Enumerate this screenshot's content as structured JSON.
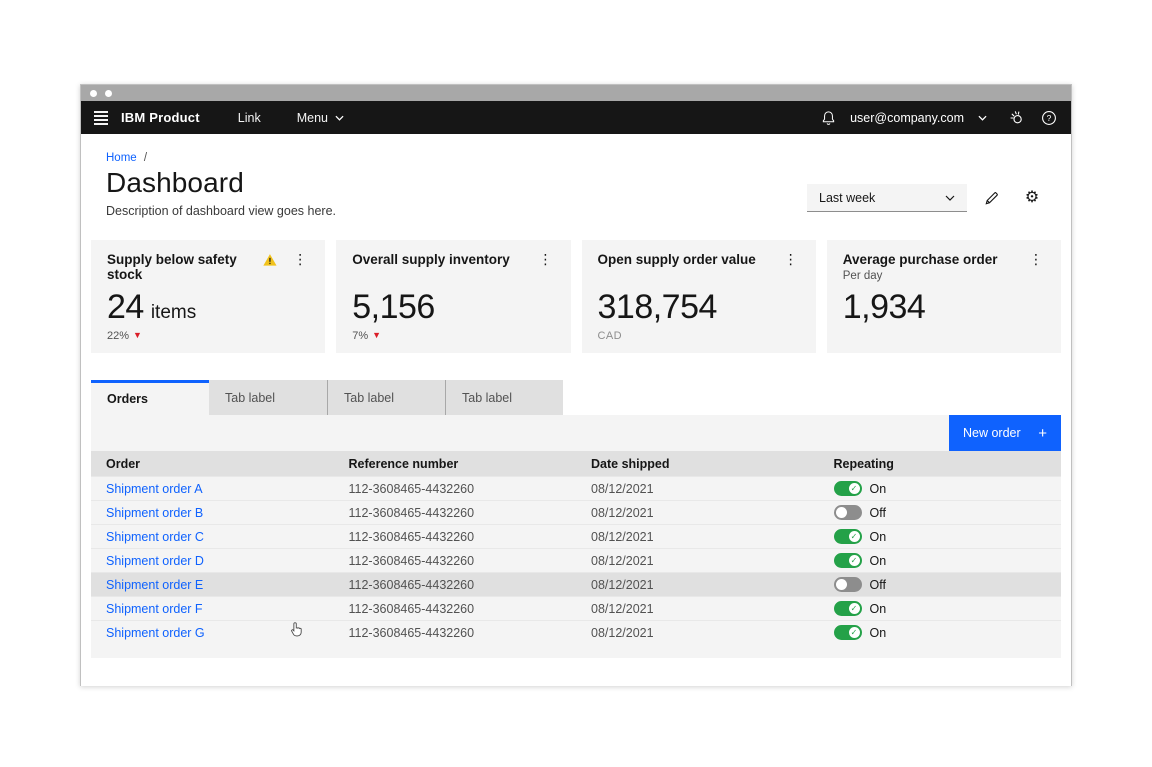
{
  "header": {
    "product": "IBM Product",
    "nav": [
      {
        "label": "Link"
      },
      {
        "label": "Menu"
      }
    ],
    "user_email": "user@company.com"
  },
  "breadcrumb": {
    "home_label": "Home",
    "separator": "/"
  },
  "page": {
    "title": "Dashboard",
    "description": "Description of dashboard view goes here."
  },
  "controls": {
    "dropdown_value": "Last week"
  },
  "cards": [
    {
      "title": "Supply below safety stock",
      "value": "24",
      "value_suffix": "items",
      "delta": "22%",
      "delta_dir": "down"
    },
    {
      "title": "Overall supply inventory",
      "value": "5,156",
      "delta": "7%",
      "delta_dir": "down"
    },
    {
      "title": "Open supply order value",
      "value": "318,754",
      "caption": "CAD"
    },
    {
      "title": "Average purchase order",
      "subtitle": "Per day",
      "value": "1,934"
    }
  ],
  "tabs": [
    {
      "label": "Orders",
      "active": true
    },
    {
      "label": "Tab label",
      "active": false
    },
    {
      "label": "Tab label",
      "active": false
    },
    {
      "label": "Tab label",
      "active": false
    }
  ],
  "table": {
    "new_order_label": "New order",
    "columns": [
      "Order",
      "Reference number",
      "Date shipped",
      "Repeating"
    ],
    "rows": [
      {
        "order": "Shipment order A",
        "reference": "112-3608465-4432260",
        "date": "08/12/2021",
        "repeating": "On"
      },
      {
        "order": "Shipment order B",
        "reference": "112-3608465-4432260",
        "date": "08/12/2021",
        "repeating": "Off"
      },
      {
        "order": "Shipment order C",
        "reference": "112-3608465-4432260",
        "date": "08/12/2021",
        "repeating": "On"
      },
      {
        "order": "Shipment order D",
        "reference": "112-3608465-4432260",
        "date": "08/12/2021",
        "repeating": "On"
      },
      {
        "order": "Shipment order E",
        "reference": "112-3608465-4432260",
        "date": "08/12/2021",
        "repeating": "Off",
        "hovered": true
      },
      {
        "order": "Shipment order F",
        "reference": "112-3608465-4432260",
        "date": "08/12/2021",
        "repeating": "On"
      },
      {
        "order": "Shipment order G",
        "reference": "112-3608465-4432260",
        "date": "08/12/2021",
        "repeating": "On"
      }
    ]
  },
  "colors": {
    "accent": "#0f62fe",
    "header_bg": "#161616",
    "warning": "#f1c21b",
    "danger": "#da1e28",
    "success": "#24a148",
    "card_bg": "#f4f4f4",
    "table_header_bg": "#e0e0e0"
  }
}
